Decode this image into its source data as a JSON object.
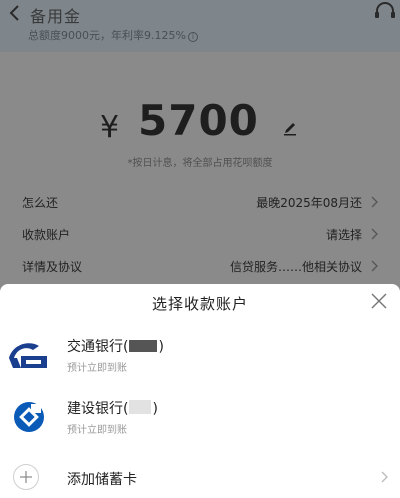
{
  "header": {
    "title": "备用金",
    "quota_text": "总额度9000元，年利率9.125%"
  },
  "amount": {
    "currency": "¥",
    "value": "5700",
    "note": "*按日计息，将全部占用花呗额度"
  },
  "rows": [
    {
      "label": "怎么还",
      "value": "最晚2025年08月还"
    },
    {
      "label": "收款账户",
      "value": "请选择"
    },
    {
      "label": "详情及协议",
      "value": "信贷服务……他相关协议"
    }
  ],
  "sheet": {
    "title": "选择收款账户",
    "banks": [
      {
        "name": "交通银行(",
        "suffix": ")",
        "sub": "预计立即到账",
        "icon": "bocom-logo-icon",
        "color": "#1a3f8f"
      },
      {
        "name": "建设银行(",
        "suffix": ")",
        "sub": "预计立即到账",
        "icon": "ccb-logo-icon",
        "color": "#0a5ab8"
      }
    ],
    "add_card": "添加储蓄卡"
  }
}
